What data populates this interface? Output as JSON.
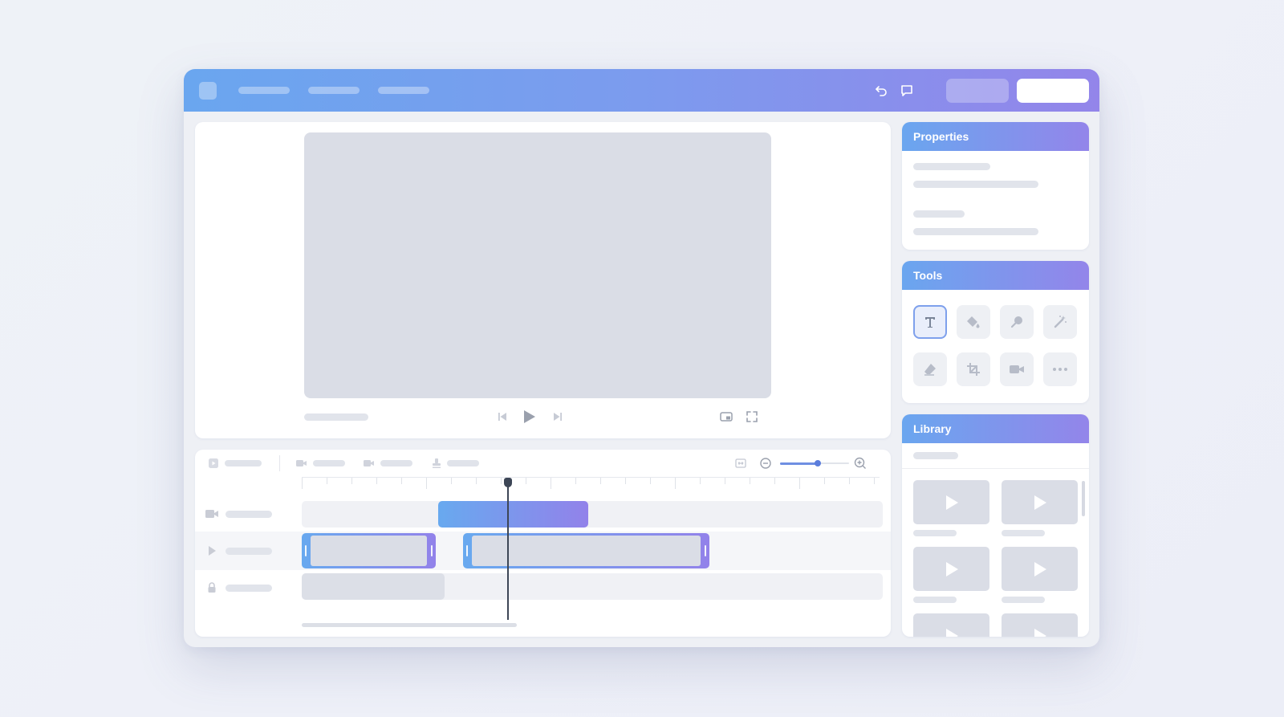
{
  "colors": {
    "accent_start": "#6aa6ef",
    "accent_end": "#9385ea",
    "playhead": "#3d4656",
    "placeholder": "#dadde6"
  },
  "topbar": {
    "icons": [
      "undo-icon",
      "comment-icon"
    ]
  },
  "player": {
    "controls": [
      "skip-back-icon",
      "play-icon",
      "skip-forward-icon"
    ],
    "right_controls": [
      "picture-in-picture-icon",
      "fullscreen-icon"
    ]
  },
  "timeline": {
    "toolbar_icons": [
      "video-clip-icon",
      "camera-icon",
      "video-camera-icon",
      "stamp-icon"
    ],
    "zoom_level": 0.55,
    "tracks": [
      {
        "icon": "video-camera-icon"
      },
      {
        "icon": "play-icon"
      },
      {
        "icon": "lock-icon"
      }
    ]
  },
  "panels": {
    "properties": {
      "title": "Properties"
    },
    "tools": {
      "title": "Tools",
      "items": [
        "text-icon",
        "paint-bucket-icon",
        "brush-icon",
        "magic-wand-icon",
        "eraser-icon",
        "crop-icon",
        "video-camera-icon",
        "more-icon"
      ],
      "active": "text-icon"
    },
    "library": {
      "title": "Library"
    }
  }
}
